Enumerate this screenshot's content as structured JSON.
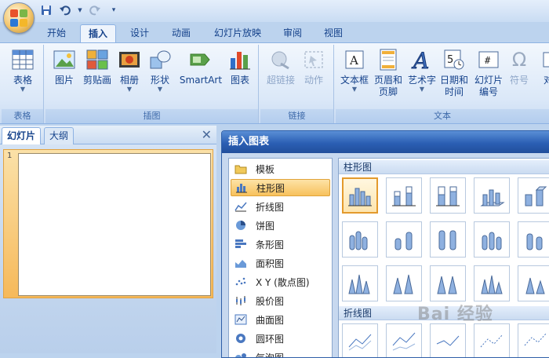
{
  "ribbon_tabs": [
    "开始",
    "插入",
    "设计",
    "动画",
    "幻灯片放映",
    "审阅",
    "视图"
  ],
  "active_tab": "插入",
  "groups": {
    "table": {
      "label": "表格",
      "buttons": [
        "表格"
      ]
    },
    "illustrations": {
      "label": "插图",
      "buttons": [
        "图片",
        "剪贴画",
        "相册",
        "形状",
        "SmartArt",
        "图表"
      ]
    },
    "links": {
      "label": "链接",
      "buttons": [
        "超链接",
        "动作"
      ]
    },
    "text": {
      "label": "文本",
      "buttons": [
        "文本框",
        "页眉和\n页脚",
        "艺术字",
        "日期和\n时间",
        "幻灯片\n编号",
        "符号",
        "对"
      ]
    }
  },
  "pane": {
    "tab_slides": "幻灯片",
    "tab_outline": "大纲",
    "slide_number": "1",
    "close": "✕"
  },
  "dialog": {
    "title": "插入图表",
    "categories": [
      "模板",
      "柱形图",
      "折线图",
      "饼图",
      "条形图",
      "面积图",
      "X Y (散点图)",
      "股价图",
      "曲面图",
      "圆环图",
      "气泡图"
    ],
    "selected_category": "柱形图",
    "sections": [
      "柱形图",
      "折线图"
    ]
  },
  "watermark": "Bai 经验",
  "colors": {
    "accent": "#2b5fb4",
    "selection": "#f7c15c",
    "ribbon_text": "#15428b"
  }
}
